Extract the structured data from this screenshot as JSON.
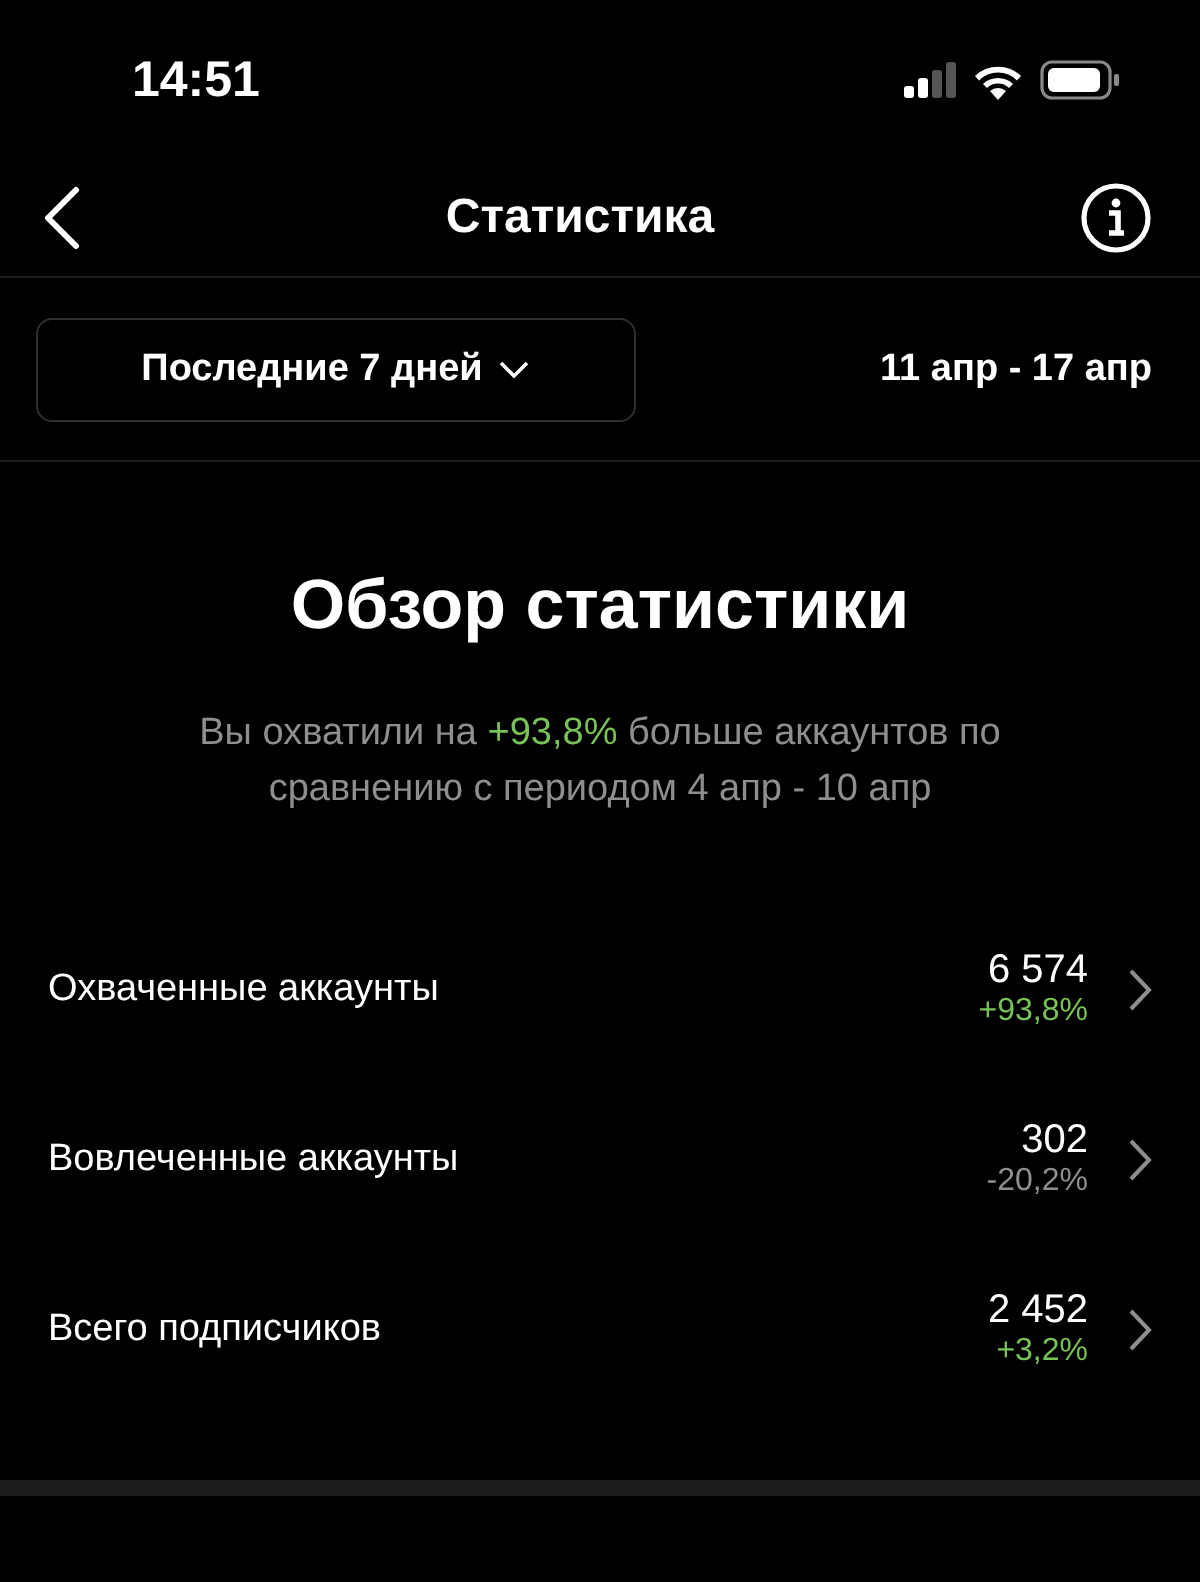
{
  "status_bar": {
    "time": "14:51"
  },
  "nav": {
    "title": "Статистика"
  },
  "filter": {
    "period": "Последние 7 дней",
    "range": "11 апр - 17 апр"
  },
  "overview": {
    "title": "Обзор статистики",
    "summary": [
      {
        "text": "Вы охватили на ",
        "color": "#8e8e8e"
      },
      {
        "text": "+93,8%",
        "color": "#78c257"
      },
      {
        "text": " больше аккаунтов по сравнению с периодом 4 апр - 10 апр",
        "color": "#8e8e8e"
      }
    ]
  },
  "metrics": [
    {
      "label": "Охваченные аккаунты",
      "value": "6 574",
      "change": "+93,8%",
      "color": "#78c257"
    },
    {
      "label": "Вовлеченные аккаунты",
      "value": "302",
      "change": "-20,2%",
      "color": "#8e8e8e"
    },
    {
      "label": "Всего подписчиков",
      "value": "2 452",
      "change": "+3,2%",
      "color": "#78c257"
    }
  ]
}
